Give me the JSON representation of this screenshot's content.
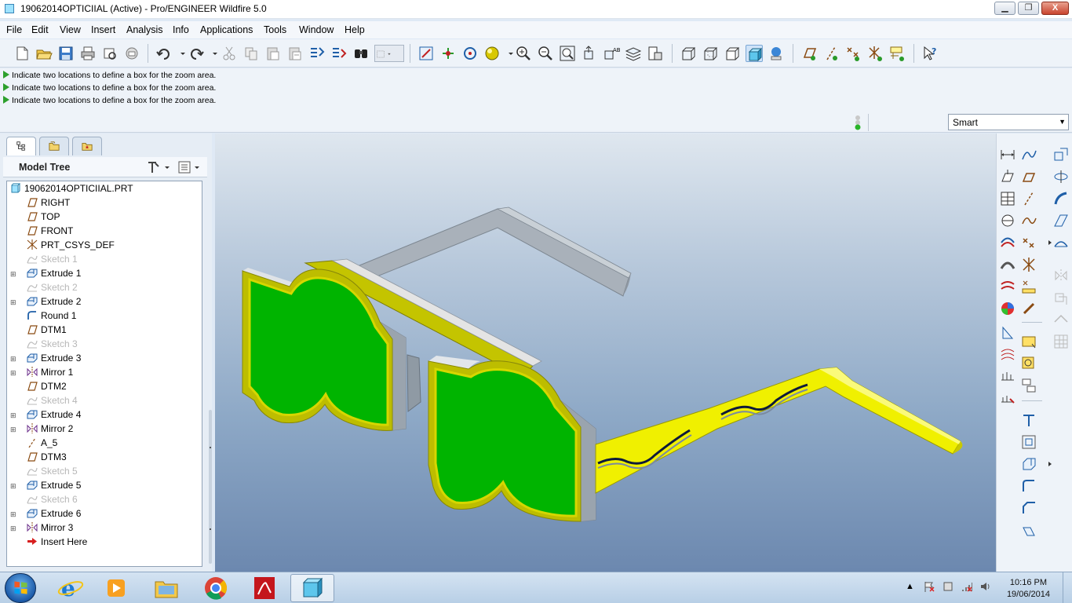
{
  "window": {
    "title": "19062014OPTICIIAL (Active) - Pro/ENGINEER Wildfire 5.0",
    "min_glyph": "▁",
    "max_glyph": "❐",
    "close_glyph": "X"
  },
  "menu": [
    "File",
    "Edit",
    "View",
    "Insert",
    "Analysis",
    "Info",
    "Applications",
    "Tools",
    "Window",
    "Help"
  ],
  "messages": [
    "Indicate two locations to define a box for the zoom area.",
    "Indicate two locations to define a box for the zoom area.",
    "Indicate two locations to define a box for the zoom area."
  ],
  "filter": {
    "value": "Smart",
    "arrow": "▼"
  },
  "nav_tabs": [
    "model-tree",
    "folder-browser",
    "favorites"
  ],
  "model_tree": {
    "header": "Model Tree",
    "root": "19062014OPTICIIAL.PRT",
    "items": [
      {
        "label": "RIGHT",
        "icon": "datum-plane-icon",
        "dim": false,
        "expandable": false
      },
      {
        "label": "TOP",
        "icon": "datum-plane-icon",
        "dim": false,
        "expandable": false
      },
      {
        "label": "FRONT",
        "icon": "datum-plane-icon",
        "dim": false,
        "expandable": false
      },
      {
        "label": "PRT_CSYS_DEF",
        "icon": "csys-icon",
        "dim": false,
        "expandable": false
      },
      {
        "label": "Sketch 1",
        "icon": "sketch-icon",
        "dim": true,
        "expandable": false
      },
      {
        "label": "Extrude 1",
        "icon": "extrude-icon",
        "dim": false,
        "expandable": true
      },
      {
        "label": "Sketch 2",
        "icon": "sketch-icon",
        "dim": true,
        "expandable": false
      },
      {
        "label": "Extrude 2",
        "icon": "extrude-icon",
        "dim": false,
        "expandable": true
      },
      {
        "label": "Round 1",
        "icon": "round-icon",
        "dim": false,
        "expandable": false
      },
      {
        "label": "DTM1",
        "icon": "datum-plane-icon",
        "dim": false,
        "expandable": false
      },
      {
        "label": "Sketch 3",
        "icon": "sketch-icon",
        "dim": true,
        "expandable": false
      },
      {
        "label": "Extrude 3",
        "icon": "extrude-icon",
        "dim": false,
        "expandable": true
      },
      {
        "label": "Mirror 1",
        "icon": "mirror-icon",
        "dim": false,
        "expandable": true
      },
      {
        "label": "DTM2",
        "icon": "datum-plane-icon",
        "dim": false,
        "expandable": false
      },
      {
        "label": "Sketch 4",
        "icon": "sketch-icon",
        "dim": true,
        "expandable": false
      },
      {
        "label": "Extrude 4",
        "icon": "extrude-icon",
        "dim": false,
        "expandable": true
      },
      {
        "label": "Mirror 2",
        "icon": "mirror-icon",
        "dim": false,
        "expandable": true
      },
      {
        "label": "A_5",
        "icon": "axis-icon",
        "dim": false,
        "expandable": false
      },
      {
        "label": "DTM3",
        "icon": "datum-plane-icon",
        "dim": false,
        "expandable": false
      },
      {
        "label": "Sketch 5",
        "icon": "sketch-icon",
        "dim": true,
        "expandable": false
      },
      {
        "label": "Extrude 5",
        "icon": "extrude-icon",
        "dim": false,
        "expandable": true
      },
      {
        "label": "Sketch 6",
        "icon": "sketch-icon",
        "dim": true,
        "expandable": false
      },
      {
        "label": "Extrude 6",
        "icon": "extrude-icon",
        "dim": false,
        "expandable": true
      },
      {
        "label": "Mirror 3",
        "icon": "mirror-icon",
        "dim": false,
        "expandable": true
      },
      {
        "label": "Insert Here",
        "icon": "insert-here-arrow-icon",
        "dim": false,
        "expandable": false
      }
    ]
  },
  "colors": {
    "lens": "#00b400",
    "frame_rim": "#d6d600",
    "temple_right": "#f0f000",
    "temple_left": "#a9b1ba",
    "frame_side": "#b8c2cc",
    "viewport_top": "#dfe7ef",
    "viewport_bottom": "#6c88af"
  },
  "clock": {
    "time": "10:16 PM",
    "date": "19/06/2014"
  },
  "taskbar": [
    "internet-explorer",
    "media-player",
    "file-explorer",
    "chrome",
    "acrobat",
    "pro-engineer"
  ]
}
